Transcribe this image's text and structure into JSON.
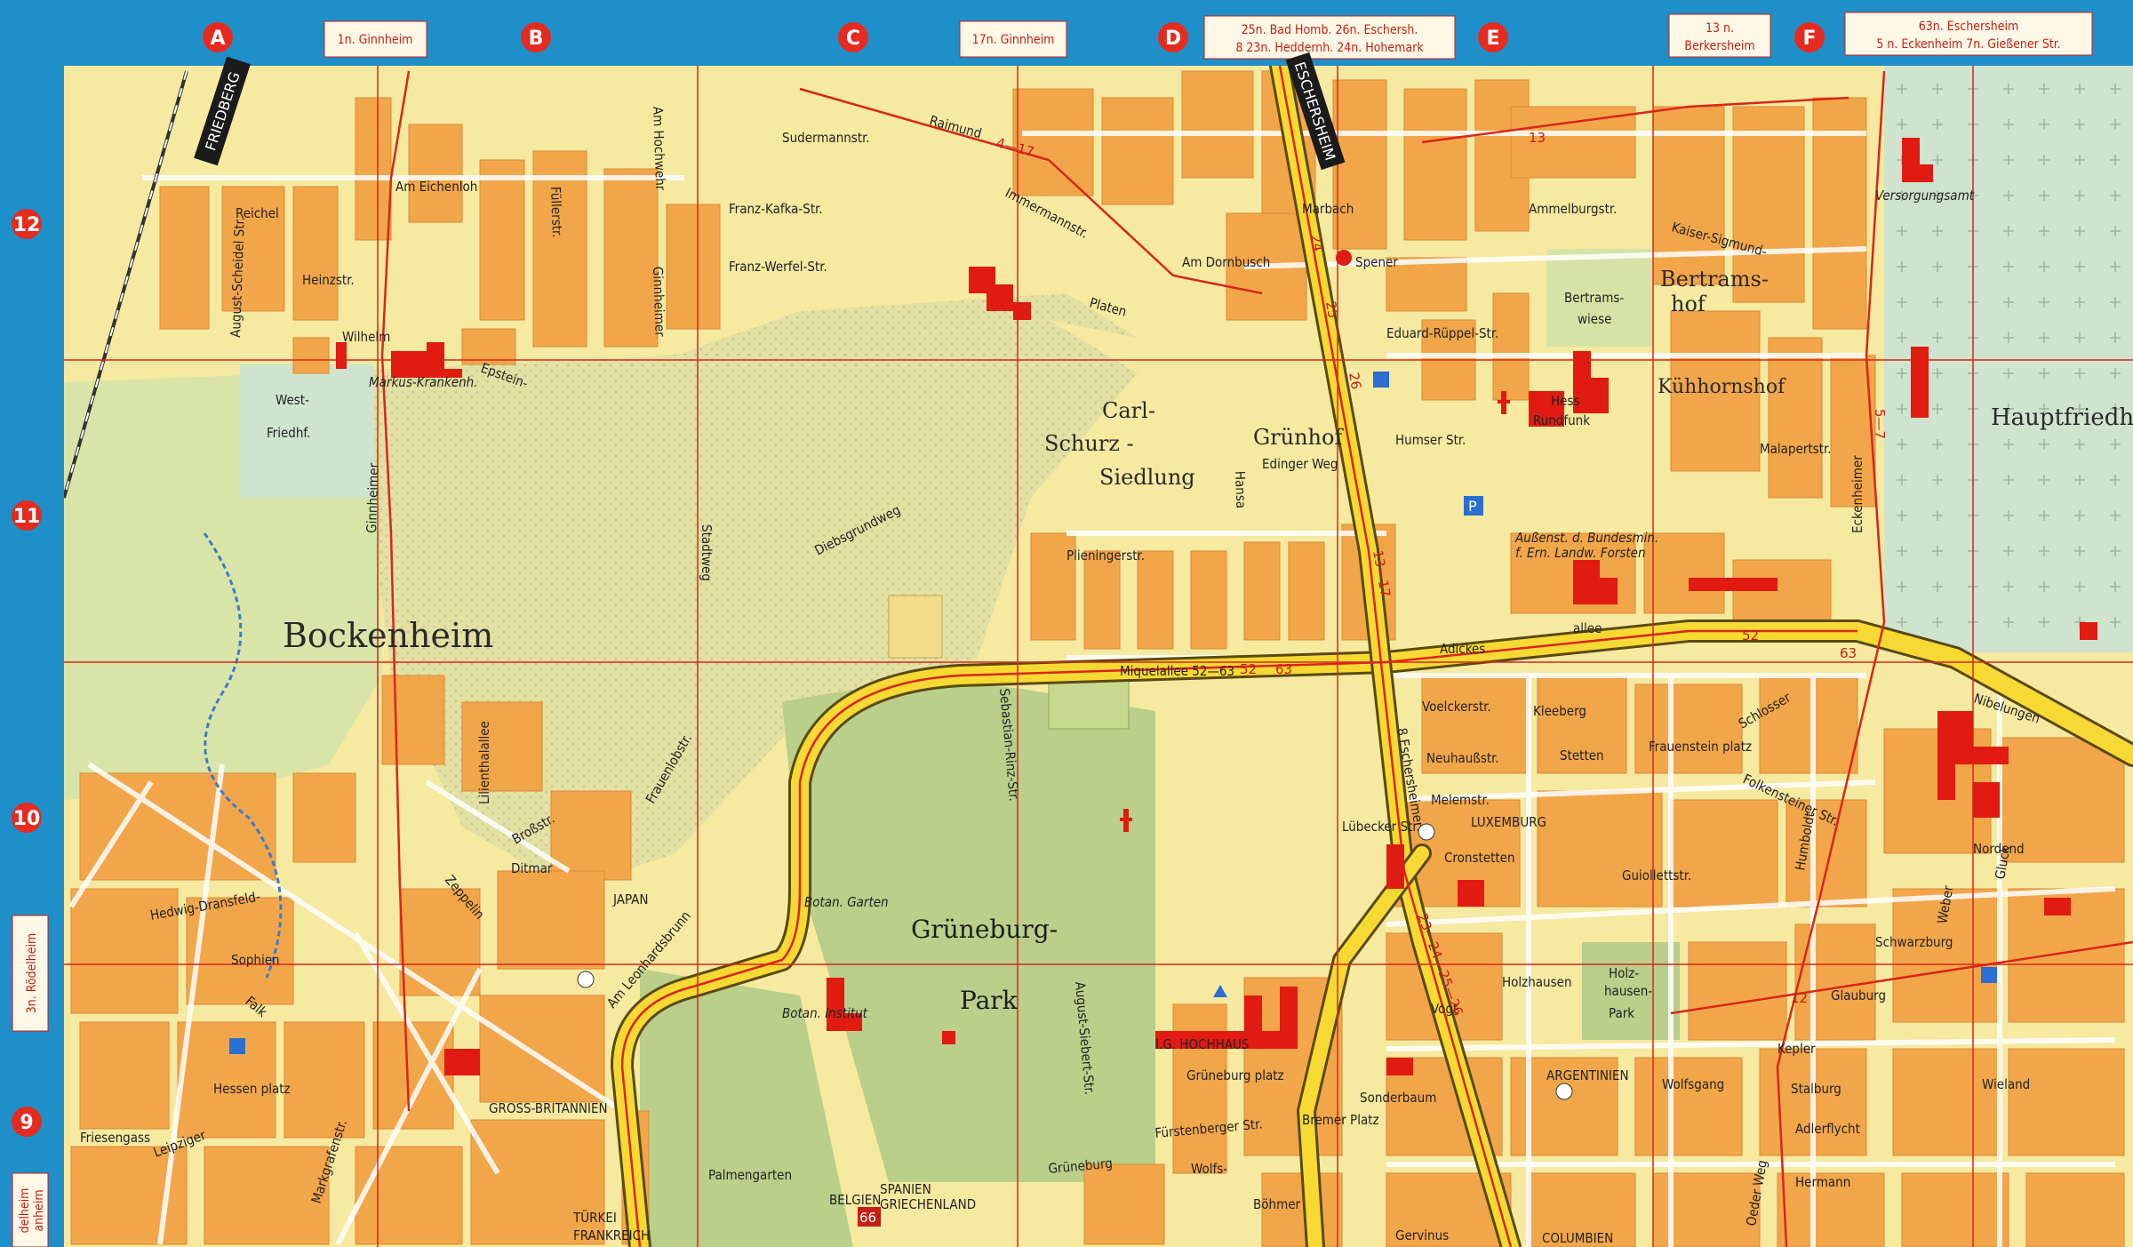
{
  "colors": {
    "frame_blue": "#1f8fc9",
    "land_yellow": "#f6e9a0",
    "block_orange": "#f2a64a",
    "park_green": "#b9cf8a",
    "cemetery_green": "#cfe3cf",
    "main_road_yellow": "#f7d934",
    "grid_red": "#d9261c",
    "landmark_red": "#e01b12"
  },
  "grid": {
    "columns": [
      "A",
      "B",
      "C",
      "D",
      "E",
      "F"
    ],
    "rows": [
      "12",
      "11",
      "10",
      "9"
    ]
  },
  "edge_labels": {
    "top": [
      {
        "id": "ginnheim-b",
        "lines": [
          "1n. Ginnheim"
        ]
      },
      {
        "id": "ginnheim-c",
        "lines": [
          "17n. Ginnheim"
        ]
      },
      {
        "id": "badhomb",
        "lines": [
          "25n. Bad Homb.  26n. Eschersh.",
          "8 23n. Heddernh.  24n. Hohemark"
        ]
      },
      {
        "id": "berkersheim",
        "lines": [
          "13 n.",
          "Berkersheim"
        ]
      },
      {
        "id": "eschersheim",
        "lines": [
          "63n. Eschersheim",
          "5 n. Eckenheim  7n. Gießener Str."
        ]
      }
    ],
    "left": [
      {
        "id": "roedelheim",
        "text": "3n. Rödelheim"
      },
      {
        "id": "roedelheim-bottom",
        "text": "delheim"
      },
      {
        "id": "bottom-2",
        "text": "anheim"
      }
    ]
  },
  "direction_signs": [
    {
      "id": "friedberg",
      "text": "FRIEDBERG"
    },
    {
      "id": "eschersheim",
      "text": "ESCHERSHEIM"
    }
  ],
  "districts": [
    {
      "id": "bockenheim",
      "text": "Bockenheim"
    },
    {
      "id": "gruneburg-park-1",
      "text": "Grüneburg-"
    },
    {
      "id": "gruneburg-park-2",
      "text": "Park"
    },
    {
      "id": "carl-schurz-1",
      "text": "Carl-"
    },
    {
      "id": "carl-schurz-2",
      "text": "Schurz -"
    },
    {
      "id": "carl-schurz-3",
      "text": "Siedlung"
    },
    {
      "id": "grunhof",
      "text": "Grünhof"
    },
    {
      "id": "bertramshof-1",
      "text": "Bertrams-"
    },
    {
      "id": "bertramshof-2",
      "text": "hof"
    },
    {
      "id": "kuhhornshof",
      "text": "Kühhornshof"
    },
    {
      "id": "hauptfriedhof",
      "text": "Hauptfriedh"
    },
    {
      "id": "west-friedhof-1",
      "text": "West-"
    },
    {
      "id": "west-friedhof-2",
      "text": "Friedhf."
    },
    {
      "id": "palmengarten",
      "text": "Palmengarten"
    },
    {
      "id": "holzhausen-park-1",
      "text": "Holz-"
    },
    {
      "id": "holzhausen-park-2",
      "text": "hausen-"
    },
    {
      "id": "holzhausen-park-3",
      "text": "Park"
    },
    {
      "id": "bertramswiese-1",
      "text": "Bertrams-"
    },
    {
      "id": "bertramswiese-2",
      "text": "wiese"
    },
    {
      "id": "hochhaus",
      "text": "I.G. HOCHHAUS"
    },
    {
      "id": "botan-garten",
      "text": "Botan. Garten"
    },
    {
      "id": "botan-institut",
      "text": "Botan. Institut"
    }
  ],
  "streets": [
    {
      "id": "miquelallee",
      "text": "Miquelallee  52—63"
    },
    {
      "id": "adickesallee",
      "text": "Adickes"
    },
    {
      "id": "adickes-allee2",
      "text": "allee"
    },
    {
      "id": "eschersheimer-landstr",
      "text": "8 Eschersheimer"
    },
    {
      "id": "nibelungen",
      "text": "Nibelungen"
    },
    {
      "id": "diebsgrundweg",
      "text": "Diebsgrundweg"
    },
    {
      "id": "ginnheimer-landstr",
      "text": "Ginnheimer"
    },
    {
      "id": "zeppelin",
      "text": "Zeppelin"
    },
    {
      "id": "hansaallee",
      "text": "Hansa"
    },
    {
      "id": "eckenheimer",
      "text": "Eckenheimer"
    },
    {
      "id": "marbach",
      "text": "Marbach"
    },
    {
      "id": "raimund",
      "text": "Raimund"
    },
    {
      "id": "immermannstr",
      "text": "Immermannstr."
    },
    {
      "id": "platen",
      "text": "Platen"
    },
    {
      "id": "am-dornbusch",
      "text": "Am Dornbusch"
    },
    {
      "id": "epstein",
      "text": "Epstein-"
    },
    {
      "id": "reichel",
      "text": "Reichel"
    },
    {
      "id": "frauenlobstr",
      "text": "Frauenlobstr."
    },
    {
      "id": "hessen-platz",
      "text": "Hessen platz"
    },
    {
      "id": "grueneburg-platz",
      "text": "Grüneburg platz"
    },
    {
      "id": "holzhausen",
      "text": "Holzhausen"
    },
    {
      "id": "fuerstenberger",
      "text": "Fürstenberger Str."
    },
    {
      "id": "sebastian-rinz",
      "text": "Sebastian-Rinz-Str."
    },
    {
      "id": "august-siebert",
      "text": "August-Siebert-Str."
    },
    {
      "id": "lueneburger",
      "text": "Lübecker Str."
    },
    {
      "id": "kleeberg",
      "text": "Kleeberg"
    },
    {
      "id": "frauenstein-platz",
      "text": "Frauenstein platz"
    },
    {
      "id": "humbold",
      "text": "Humboldt"
    },
    {
      "id": "oeder-weg",
      "text": "Oeder Weg"
    },
    {
      "id": "stalburg",
      "text": "Stalburg"
    },
    {
      "id": "glauburg",
      "text": "Glauburg"
    },
    {
      "id": "kepler",
      "text": "Kepler"
    },
    {
      "id": "wieland",
      "text": "Wieland"
    },
    {
      "id": "vogt",
      "text": "Vogt"
    },
    {
      "id": "hermann",
      "text": "Hermann"
    },
    {
      "id": "adlerflycht",
      "text": "Adlerflycht"
    },
    {
      "id": "schwarzburg",
      "text": "Schwarzburg"
    },
    {
      "id": "bremer-platz",
      "text": "Bremer Platz"
    },
    {
      "id": "gervinus",
      "text": "Gervinus"
    },
    {
      "id": "wolfsgang",
      "text": "Wolfsgang"
    },
    {
      "id": "wolfs",
      "text": "Wolfs-"
    },
    {
      "id": "boehmer",
      "text": "Böhmer"
    },
    {
      "id": "grueneburg",
      "text": "Grüneburg"
    },
    {
      "id": "leipziger",
      "text": "Leipziger"
    },
    {
      "id": "friesengasse",
      "text": "Friesengass"
    },
    {
      "id": "hedwig",
      "text": "Hedwig-Dransfeld-"
    },
    {
      "id": "sophien",
      "text": "Sophien"
    },
    {
      "id": "falk",
      "text": "Falk"
    },
    {
      "id": "kurfuersten",
      "text": "Markgrafenstr."
    },
    {
      "id": "stadtweg",
      "text": "Stadtweg"
    },
    {
      "id": "lilienthal",
      "text": "Lilienthalallee"
    },
    {
      "id": "dittmar",
      "text": "Ditmar"
    },
    {
      "id": "brossstr",
      "text": "Broßstr."
    },
    {
      "id": "am-leonhardsbrunn",
      "text": "Am Leonhardsbrunn"
    },
    {
      "id": "fuellerstr",
      "text": "Füllerstr."
    },
    {
      "id": "am-hochwehr",
      "text": "Am Hochwehr"
    },
    {
      "id": "ginnheimer-str",
      "text": "Ginnheimer"
    },
    {
      "id": "kuhwaldstr",
      "text": "August-Scheidel Str."
    },
    {
      "id": "am-eichenloh",
      "text": "Am Eichenloh"
    },
    {
      "id": "heinzstr",
      "text": "Heinzstr."
    },
    {
      "id": "wilhelm",
      "text": "Wilhelm"
    },
    {
      "id": "markus-krankenh",
      "text": "Markus-Krankenh."
    },
    {
      "id": "franz-werfel",
      "text": "Franz-Werfel-Str."
    },
    {
      "id": "franz-kafka",
      "text": "Franz-Kafka-Str."
    },
    {
      "id": "sudermannstr",
      "text": "Sudermannstr."
    },
    {
      "id": "plieningerstr",
      "text": "Plieningerstr."
    },
    {
      "id": "edinger-weg",
      "text": "Edinger Weg"
    },
    {
      "id": "humserstr",
      "text": "Humser Str."
    },
    {
      "id": "eduard-rueppel",
      "text": "Eduard-Rüppel-Str."
    },
    {
      "id": "ammelburgstr",
      "text": "Ammelburgstr."
    },
    {
      "id": "spener",
      "text": "Spener"
    },
    {
      "id": "versorgungsamt",
      "text": "Versorgungsamt"
    },
    {
      "id": "malapertstr",
      "text": "Malapertstr."
    },
    {
      "id": "kaiser-sigmund",
      "text": "Kaiser-Sigmund-"
    },
    {
      "id": "voelckerstr",
      "text": "Voelckerstr."
    },
    {
      "id": "neuhaubstr",
      "text": "Neuhaußstr."
    },
    {
      "id": "melemstr",
      "text": "Melemstr."
    },
    {
      "id": "cronstetten",
      "text": "Cronstetten"
    },
    {
      "id": "stetten",
      "text": "Stetten"
    },
    {
      "id": "falkstr",
      "text": "Folkensteiner Str."
    },
    {
      "id": "nordend",
      "text": "Nordend"
    },
    {
      "id": "gluckstr",
      "text": "Gluck"
    },
    {
      "id": "weberstr",
      "text": "Weber"
    },
    {
      "id": "guiollettstr",
      "text": "Guiollettstr."
    },
    {
      "id": "sonderbaum",
      "text": "Sonderbaum"
    },
    {
      "id": "schloss",
      "text": "Schlosser"
    }
  ],
  "institutions": [
    {
      "id": "japan",
      "text": "JAPAN"
    },
    {
      "id": "luxemburg",
      "text": "LUXEMBURG"
    },
    {
      "id": "argentinien",
      "text": "ARGENTINIEN"
    },
    {
      "id": "gross-britannien",
      "text": "GROSS-BRITANNIEN"
    },
    {
      "id": "tuerkei",
      "text": "TÜRKEI"
    },
    {
      "id": "frankreich",
      "text": "FRANKREICH"
    },
    {
      "id": "spanien",
      "text": "SPANIEN"
    },
    {
      "id": "griechenland",
      "text": "GRIECHENLAND"
    },
    {
      "id": "belgien",
      "text": "BELGIEN"
    },
    {
      "id": "columbien",
      "text": "COLUMBIEN"
    },
    {
      "id": "hess-rundfunk-1",
      "text": "Hess"
    },
    {
      "id": "hess-rundfunk-2",
      "text": "Rundfunk"
    },
    {
      "id": "bundesmin",
      "text": "Außenst. d. Bundesmin."
    },
    {
      "id": "bundesmin-2",
      "text": "f. Ern. Landw. Forsten"
    }
  ],
  "tram_numbers": [
    {
      "id": "t-52-1",
      "text": "52"
    },
    {
      "id": "t-63-1",
      "text": "63"
    },
    {
      "id": "t-52-2",
      "text": "52"
    },
    {
      "id": "t-63-2",
      "text": "63"
    },
    {
      "id": "t-24",
      "text": "24"
    },
    {
      "id": "t-25",
      "text": "25"
    },
    {
      "id": "t-26",
      "text": "26"
    },
    {
      "id": "t-13-17",
      "text": "13—17"
    },
    {
      "id": "t-23-24",
      "text": "23—24—25—26"
    },
    {
      "id": "t-4-17",
      "text": "4—17"
    },
    {
      "id": "t-13",
      "text": "13"
    },
    {
      "id": "t-5-7",
      "text": "5—7"
    },
    {
      "id": "t-12",
      "text": "12"
    },
    {
      "id": "t-66",
      "text": "66"
    }
  ]
}
